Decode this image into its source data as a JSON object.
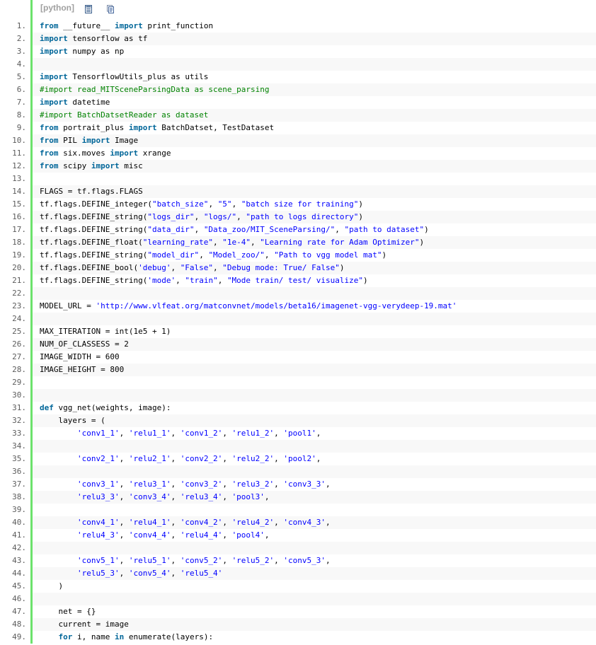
{
  "toolbar": {
    "language_label": "[python]",
    "view_icon": "view-source-icon",
    "copy_icon": "copy-icon"
  },
  "colors": {
    "gutter_bar": "#6ce26c",
    "keyword": "#006699",
    "string": "#0000ff",
    "comment": "#008200",
    "line_number": "#5c5c5c",
    "alt_row": "#f8f8f8"
  },
  "lines": [
    {
      "n": "1.",
      "tokens": [
        {
          "t": "from",
          "k": "kw"
        },
        {
          "t": " __future__ "
        },
        {
          "t": "import",
          "k": "kw"
        },
        {
          "t": " print_function"
        }
      ]
    },
    {
      "n": "2.",
      "tokens": [
        {
          "t": "import",
          "k": "kw"
        },
        {
          "t": " tensorflow as tf"
        }
      ]
    },
    {
      "n": "3.",
      "tokens": [
        {
          "t": "import",
          "k": "kw"
        },
        {
          "t": " numpy as np"
        }
      ]
    },
    {
      "n": "4.",
      "tokens": []
    },
    {
      "n": "5.",
      "tokens": [
        {
          "t": "import",
          "k": "kw"
        },
        {
          "t": " TensorflowUtils_plus as utils"
        }
      ]
    },
    {
      "n": "6.",
      "tokens": [
        {
          "t": "#import read_MITSceneParsingData as scene_parsing",
          "k": "cmt"
        }
      ]
    },
    {
      "n": "7.",
      "tokens": [
        {
          "t": "import",
          "k": "kw"
        },
        {
          "t": " datetime"
        }
      ]
    },
    {
      "n": "8.",
      "tokens": [
        {
          "t": "#import BatchDatsetReader as dataset",
          "k": "cmt"
        }
      ]
    },
    {
      "n": "9.",
      "tokens": [
        {
          "t": "from",
          "k": "kw"
        },
        {
          "t": " portrait_plus "
        },
        {
          "t": "import",
          "k": "kw"
        },
        {
          "t": " BatchDatset, TestDataset"
        }
      ]
    },
    {
      "n": "10.",
      "tokens": [
        {
          "t": "from",
          "k": "kw"
        },
        {
          "t": " PIL "
        },
        {
          "t": "import",
          "k": "kw"
        },
        {
          "t": " Image"
        }
      ]
    },
    {
      "n": "11.",
      "tokens": [
        {
          "t": "from",
          "k": "kw"
        },
        {
          "t": " six.moves "
        },
        {
          "t": "import",
          "k": "kw"
        },
        {
          "t": " xrange"
        }
      ]
    },
    {
      "n": "12.",
      "tokens": [
        {
          "t": "from",
          "k": "kw"
        },
        {
          "t": " scipy "
        },
        {
          "t": "import",
          "k": "kw"
        },
        {
          "t": " misc"
        }
      ]
    },
    {
      "n": "13.",
      "tokens": []
    },
    {
      "n": "14.",
      "tokens": [
        {
          "t": "FLAGS = tf.flags.FLAGS"
        }
      ]
    },
    {
      "n": "15.",
      "tokens": [
        {
          "t": "tf.flags.DEFINE_integer("
        },
        {
          "t": "\"batch_size\"",
          "k": "str"
        },
        {
          "t": ", "
        },
        {
          "t": "\"5\"",
          "k": "str"
        },
        {
          "t": ", "
        },
        {
          "t": "\"batch size for training\"",
          "k": "str"
        },
        {
          "t": ")"
        }
      ]
    },
    {
      "n": "16.",
      "tokens": [
        {
          "t": "tf.flags.DEFINE_string("
        },
        {
          "t": "\"logs_dir\"",
          "k": "str"
        },
        {
          "t": ", "
        },
        {
          "t": "\"logs/\"",
          "k": "str"
        },
        {
          "t": ", "
        },
        {
          "t": "\"path to logs directory\"",
          "k": "str"
        },
        {
          "t": ")"
        }
      ]
    },
    {
      "n": "17.",
      "tokens": [
        {
          "t": "tf.flags.DEFINE_string("
        },
        {
          "t": "\"data_dir\"",
          "k": "str"
        },
        {
          "t": ", "
        },
        {
          "t": "\"Data_zoo/MIT_SceneParsing/\"",
          "k": "str"
        },
        {
          "t": ", "
        },
        {
          "t": "\"path to dataset\"",
          "k": "str"
        },
        {
          "t": ")"
        }
      ]
    },
    {
      "n": "18.",
      "tokens": [
        {
          "t": "tf.flags.DEFINE_float("
        },
        {
          "t": "\"learning_rate\"",
          "k": "str"
        },
        {
          "t": ", "
        },
        {
          "t": "\"1e-4\"",
          "k": "str"
        },
        {
          "t": ", "
        },
        {
          "t": "\"Learning rate for Adam Optimizer\"",
          "k": "str"
        },
        {
          "t": ")"
        }
      ]
    },
    {
      "n": "19.",
      "tokens": [
        {
          "t": "tf.flags.DEFINE_string("
        },
        {
          "t": "\"model_dir\"",
          "k": "str"
        },
        {
          "t": ", "
        },
        {
          "t": "\"Model_zoo/\"",
          "k": "str"
        },
        {
          "t": ", "
        },
        {
          "t": "\"Path to vgg model mat\"",
          "k": "str"
        },
        {
          "t": ")"
        }
      ]
    },
    {
      "n": "20.",
      "tokens": [
        {
          "t": "tf.flags.DEFINE_bool("
        },
        {
          "t": "'debug'",
          "k": "str"
        },
        {
          "t": ", "
        },
        {
          "t": "\"False\"",
          "k": "str"
        },
        {
          "t": ", "
        },
        {
          "t": "\"Debug mode: True/ False\"",
          "k": "str"
        },
        {
          "t": ")"
        }
      ]
    },
    {
      "n": "21.",
      "tokens": [
        {
          "t": "tf.flags.DEFINE_string("
        },
        {
          "t": "'mode'",
          "k": "str"
        },
        {
          "t": ", "
        },
        {
          "t": "\"train\"",
          "k": "str"
        },
        {
          "t": ", "
        },
        {
          "t": "\"Mode train/ test/ visualize\"",
          "k": "str"
        },
        {
          "t": ")"
        }
      ]
    },
    {
      "n": "22.",
      "tokens": []
    },
    {
      "n": "23.",
      "tokens": [
        {
          "t": "MODEL_URL = "
        },
        {
          "t": "'http://www.vlfeat.org/matconvnet/models/beta16/imagenet-vgg-verydeep-19.mat'",
          "k": "str"
        }
      ]
    },
    {
      "n": "24.",
      "tokens": []
    },
    {
      "n": "25.",
      "tokens": [
        {
          "t": "MAX_ITERATION = int(1e5 + 1)"
        }
      ]
    },
    {
      "n": "26.",
      "tokens": [
        {
          "t": "NUM_OF_CLASSESS = 2"
        }
      ]
    },
    {
      "n": "27.",
      "tokens": [
        {
          "t": "IMAGE_WIDTH = 600"
        }
      ]
    },
    {
      "n": "28.",
      "tokens": [
        {
          "t": "IMAGE_HEIGHT = 800"
        }
      ]
    },
    {
      "n": "29.",
      "tokens": []
    },
    {
      "n": "30.",
      "tokens": []
    },
    {
      "n": "31.",
      "tokens": [
        {
          "t": "def",
          "k": "kw"
        },
        {
          "t": " vgg_net(weights, image):"
        }
      ]
    },
    {
      "n": "32.",
      "tokens": [
        {
          "t": "    layers = ("
        }
      ]
    },
    {
      "n": "33.",
      "tokens": [
        {
          "t": "        "
        },
        {
          "t": "'conv1_1'",
          "k": "str"
        },
        {
          "t": ", "
        },
        {
          "t": "'relu1_1'",
          "k": "str"
        },
        {
          "t": ", "
        },
        {
          "t": "'conv1_2'",
          "k": "str"
        },
        {
          "t": ", "
        },
        {
          "t": "'relu1_2'",
          "k": "str"
        },
        {
          "t": ", "
        },
        {
          "t": "'pool1'",
          "k": "str"
        },
        {
          "t": ","
        }
      ]
    },
    {
      "n": "34.",
      "tokens": []
    },
    {
      "n": "35.",
      "tokens": [
        {
          "t": "        "
        },
        {
          "t": "'conv2_1'",
          "k": "str"
        },
        {
          "t": ", "
        },
        {
          "t": "'relu2_1'",
          "k": "str"
        },
        {
          "t": ", "
        },
        {
          "t": "'conv2_2'",
          "k": "str"
        },
        {
          "t": ", "
        },
        {
          "t": "'relu2_2'",
          "k": "str"
        },
        {
          "t": ", "
        },
        {
          "t": "'pool2'",
          "k": "str"
        },
        {
          "t": ","
        }
      ]
    },
    {
      "n": "36.",
      "tokens": []
    },
    {
      "n": "37.",
      "tokens": [
        {
          "t": "        "
        },
        {
          "t": "'conv3_1'",
          "k": "str"
        },
        {
          "t": ", "
        },
        {
          "t": "'relu3_1'",
          "k": "str"
        },
        {
          "t": ", "
        },
        {
          "t": "'conv3_2'",
          "k": "str"
        },
        {
          "t": ", "
        },
        {
          "t": "'relu3_2'",
          "k": "str"
        },
        {
          "t": ", "
        },
        {
          "t": "'conv3_3'",
          "k": "str"
        },
        {
          "t": ","
        }
      ]
    },
    {
      "n": "38.",
      "tokens": [
        {
          "t": "        "
        },
        {
          "t": "'relu3_3'",
          "k": "str"
        },
        {
          "t": ", "
        },
        {
          "t": "'conv3_4'",
          "k": "str"
        },
        {
          "t": ", "
        },
        {
          "t": "'relu3_4'",
          "k": "str"
        },
        {
          "t": ", "
        },
        {
          "t": "'pool3'",
          "k": "str"
        },
        {
          "t": ","
        }
      ]
    },
    {
      "n": "39.",
      "tokens": []
    },
    {
      "n": "40.",
      "tokens": [
        {
          "t": "        "
        },
        {
          "t": "'conv4_1'",
          "k": "str"
        },
        {
          "t": ", "
        },
        {
          "t": "'relu4_1'",
          "k": "str"
        },
        {
          "t": ", "
        },
        {
          "t": "'conv4_2'",
          "k": "str"
        },
        {
          "t": ", "
        },
        {
          "t": "'relu4_2'",
          "k": "str"
        },
        {
          "t": ", "
        },
        {
          "t": "'conv4_3'",
          "k": "str"
        },
        {
          "t": ","
        }
      ]
    },
    {
      "n": "41.",
      "tokens": [
        {
          "t": "        "
        },
        {
          "t": "'relu4_3'",
          "k": "str"
        },
        {
          "t": ", "
        },
        {
          "t": "'conv4_4'",
          "k": "str"
        },
        {
          "t": ", "
        },
        {
          "t": "'relu4_4'",
          "k": "str"
        },
        {
          "t": ", "
        },
        {
          "t": "'pool4'",
          "k": "str"
        },
        {
          "t": ","
        }
      ]
    },
    {
      "n": "42.",
      "tokens": []
    },
    {
      "n": "43.",
      "tokens": [
        {
          "t": "        "
        },
        {
          "t": "'conv5_1'",
          "k": "str"
        },
        {
          "t": ", "
        },
        {
          "t": "'relu5_1'",
          "k": "str"
        },
        {
          "t": ", "
        },
        {
          "t": "'conv5_2'",
          "k": "str"
        },
        {
          "t": ", "
        },
        {
          "t": "'relu5_2'",
          "k": "str"
        },
        {
          "t": ", "
        },
        {
          "t": "'conv5_3'",
          "k": "str"
        },
        {
          "t": ","
        }
      ]
    },
    {
      "n": "44.",
      "tokens": [
        {
          "t": "        "
        },
        {
          "t": "'relu5_3'",
          "k": "str"
        },
        {
          "t": ", "
        },
        {
          "t": "'conv5_4'",
          "k": "str"
        },
        {
          "t": ", "
        },
        {
          "t": "'relu5_4'",
          "k": "str"
        }
      ]
    },
    {
      "n": "45.",
      "tokens": [
        {
          "t": "    )"
        }
      ]
    },
    {
      "n": "46.",
      "tokens": []
    },
    {
      "n": "47.",
      "tokens": [
        {
          "t": "    net = {}"
        }
      ]
    },
    {
      "n": "48.",
      "tokens": [
        {
          "t": "    current = image"
        }
      ]
    },
    {
      "n": "49.",
      "tokens": [
        {
          "t": "    "
        },
        {
          "t": "for",
          "k": "kw"
        },
        {
          "t": " i, name "
        },
        {
          "t": "in",
          "k": "kw"
        },
        {
          "t": " enumerate(layers):"
        }
      ]
    }
  ]
}
